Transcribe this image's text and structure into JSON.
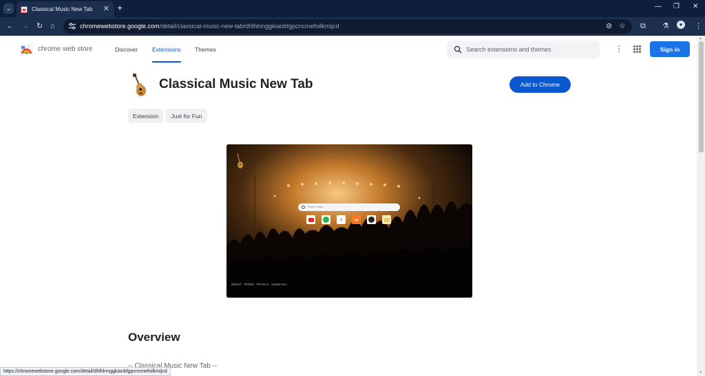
{
  "browser": {
    "tab_title": "Classical Music New Tab",
    "url_host": "chromewebstore.google.com",
    "url_path": "/detail/classical-music-new-tab/dhlhlnnggkianbfgpcncmefoilkmijcd",
    "status_url": "https://chromewebstore.google.com/detail/dhlhlnnggkianbfgpcncmefoilkmijcd"
  },
  "store": {
    "brand": "chrome web store",
    "nav": [
      "Discover",
      "Extensions",
      "Themes"
    ],
    "active_nav": "Extensions",
    "search_placeholder": "Search extensions and themes",
    "signin_label": "Sign in"
  },
  "extension": {
    "title": "Classical Music New Tab",
    "add_button": "Add to Chrome",
    "chips": [
      "Extension",
      "Just for Fun"
    ],
    "overview_heading": "Overview",
    "description_start": "-- Classical Music New Tab --"
  },
  "screenshot": {
    "search_placeholder": "Search apps",
    "footer_links": [
      "ABOUT",
      "TERMS",
      "PRIVACY",
      "UNINSTALL"
    ]
  },
  "colors": {
    "primary": "#0b57d0",
    "signin": "#1a73e8",
    "browser_frame": "#1c2f4f"
  },
  "icons": [
    "tab-search-icon",
    "close-icon",
    "plus-icon",
    "back-icon",
    "forward-icon",
    "reload-icon",
    "home-icon",
    "tune-icon",
    "eye-off-icon",
    "star-icon",
    "extensions-icon",
    "labs-icon",
    "profile-icon",
    "menu-icon",
    "search-icon",
    "apps-icon",
    "guitar-icon"
  ]
}
